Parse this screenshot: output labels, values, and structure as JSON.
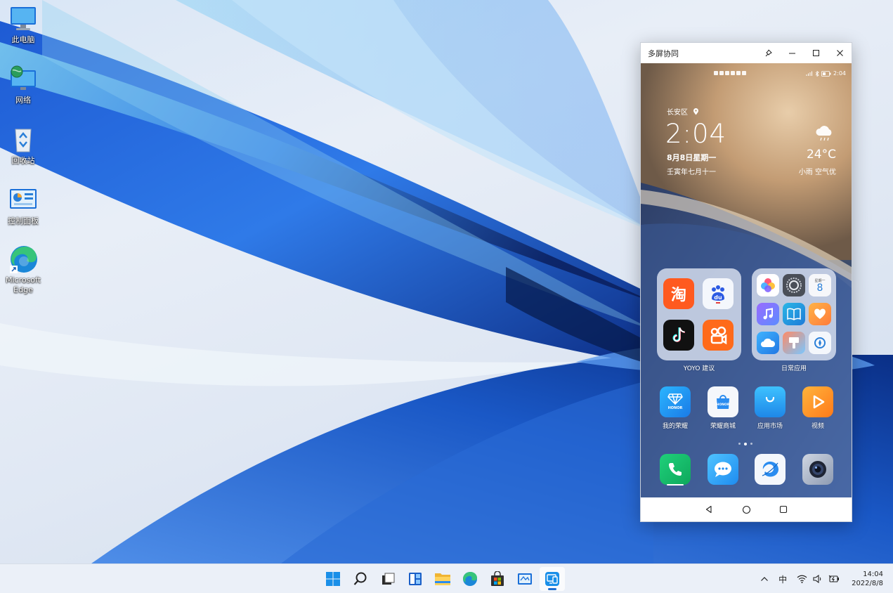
{
  "desktop": {
    "icons": [
      {
        "label": "此电脑"
      },
      {
        "label": "网络"
      },
      {
        "label": "回收站"
      },
      {
        "label": "控制面板"
      },
      {
        "label": "Microsoft Edge"
      }
    ]
  },
  "window": {
    "title": "多屏协同",
    "buttons": {
      "pin": "pin-icon",
      "minimize": "minimize-icon",
      "maximize": "maximize-icon",
      "close": "close-icon"
    }
  },
  "phone": {
    "status": {
      "time": "2:04"
    },
    "weather": {
      "location": "长安区",
      "time": "2:04",
      "date": "8月8日星期一",
      "lunar": "壬寅年七月十一",
      "temperature": "24°C",
      "condition": "小雨  空气优"
    },
    "folders": [
      {
        "label": "YOYO 建议"
      },
      {
        "label": "日常应用"
      }
    ],
    "calendar_mini": {
      "weekday": "星期一",
      "day": "8"
    },
    "apps": [
      {
        "label": "我的荣耀",
        "brand": "HONOR"
      },
      {
        "label": "荣耀商城",
        "brand": "HONOR"
      },
      {
        "label": "应用市场"
      },
      {
        "label": "视频"
      }
    ]
  },
  "taskbar": {
    "tray": {
      "ime": "中"
    },
    "clock": {
      "time": "14:04",
      "date": "2022/8/8"
    }
  },
  "colors": {
    "accent": "#1f6fd1",
    "taskbar_bg": "#ebf0f8"
  }
}
